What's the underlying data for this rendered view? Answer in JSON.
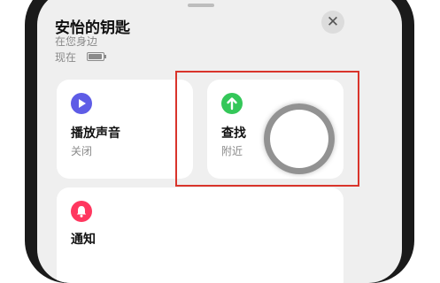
{
  "sheet": {
    "title": "安怡的钥匙",
    "location": "在您身边",
    "time_label": "现在",
    "close_label": "✕"
  },
  "cards": {
    "play_sound": {
      "label": "播放声音",
      "status": "关闭",
      "icon": "play-icon",
      "color": "#5e5ce6"
    },
    "find": {
      "label": "查找",
      "status": "附近",
      "icon": "arrow-up-icon",
      "color": "#34c759"
    },
    "notifications": {
      "label": "通知",
      "icon": "bell-icon",
      "color": "#ff375f"
    }
  },
  "colors": {
    "highlight": "#d9342b",
    "sheet_background": "#efefef"
  }
}
